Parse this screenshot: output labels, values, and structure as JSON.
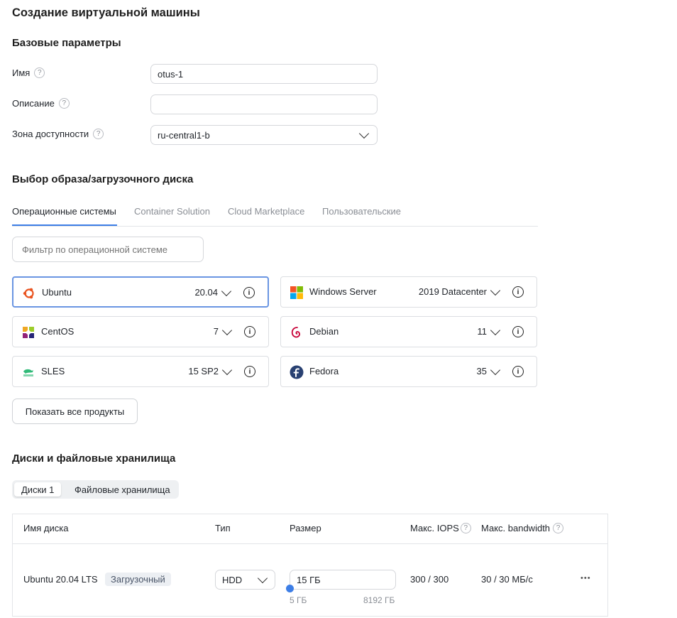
{
  "page_title": "Создание виртуальной машины",
  "basic": {
    "heading": "Базовые параметры",
    "name_label": "Имя",
    "name_value": "otus-1",
    "description_label": "Описание",
    "description_value": "",
    "zone_label": "Зона доступности",
    "zone_value": "ru-central1-b",
    "help_glyph": "?"
  },
  "image": {
    "heading": "Выбор образа/загрузочного диска",
    "tabs": [
      "Операционные системы",
      "Container Solution",
      "Cloud Marketplace",
      "Пользовательские"
    ],
    "active_tab": 0,
    "filter_placeholder": "Фильтр по операционной системе",
    "os_cards": [
      {
        "name": "Ubuntu",
        "version": "20.04",
        "icon": "ubuntu-logo",
        "selected": true
      },
      {
        "name": "Windows Server",
        "version": "2019 Datacenter",
        "icon": "windows-logo",
        "selected": false
      },
      {
        "name": "CentOS",
        "version": "7",
        "icon": "centos-logo",
        "selected": false
      },
      {
        "name": "Debian",
        "version": "11",
        "icon": "debian-logo",
        "selected": false
      },
      {
        "name": "SLES",
        "version": "15 SP2",
        "icon": "suse-logo",
        "selected": false
      },
      {
        "name": "Fedora",
        "version": "35",
        "icon": "fedora-logo",
        "selected": false
      }
    ],
    "info_glyph": "i",
    "show_all_label": "Показать все продукты"
  },
  "disks": {
    "heading": "Диски и файловые хранилища",
    "segments": [
      "Диски 1",
      "Файловые хранилища"
    ],
    "active_segment": 0,
    "columns": [
      "Имя диска",
      "Тип",
      "Размер",
      "Макс. IOPS",
      "Макс. bandwidth"
    ],
    "row": {
      "name": "Ubuntu 20.04 LTS",
      "badge": "Загрузочный",
      "type": "HDD",
      "size": "15 ГБ",
      "size_min": "5 ГБ",
      "size_max": "8192 ГБ",
      "iops": "300 / 300",
      "bandwidth": "30 / 30 МБ/с",
      "menu_glyph": "•••"
    }
  },
  "colors": {
    "accent": "#3d7ee6",
    "selected_border": "#6a95e2",
    "muted_text": "#8a8e95"
  }
}
